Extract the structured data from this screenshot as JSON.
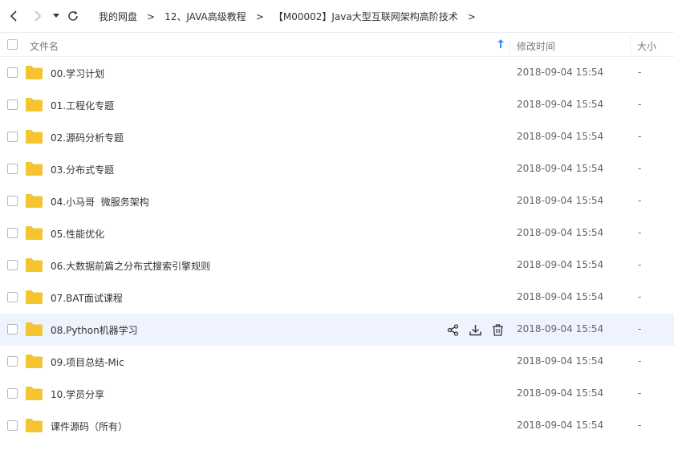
{
  "toolbar": {
    "back_icon": "chevron-left-icon",
    "forward_icon": "chevron-right-icon",
    "dropdown_icon": "caret-down-icon",
    "refresh_icon": "refresh-icon"
  },
  "breadcrumb": {
    "items": [
      "我的网盘",
      "12、JAVA高级教程",
      "【M00002】Java大型互联网架构高阶技术"
    ],
    "separator": ">"
  },
  "header": {
    "name_label": "文件名",
    "time_label": "修改时间",
    "size_label": "大小",
    "sort_icon": "arrow-up-icon"
  },
  "colors": {
    "folder": "#f5c431",
    "hover_row": "#eef3fe",
    "sort_arrow": "#3b8cff"
  },
  "files": [
    {
      "name": "00.学习计划",
      "date": "2018-09-04 15:54",
      "size": "-"
    },
    {
      "name": "01.工程化专题",
      "date": "2018-09-04 15:54",
      "size": "-"
    },
    {
      "name": "02.源码分析专题",
      "date": "2018-09-04 15:54",
      "size": "-"
    },
    {
      "name": "03.分布式专题",
      "date": "2018-09-04 15:54",
      "size": "-"
    },
    {
      "name": "04.小马哥  微服务架构",
      "date": "2018-09-04 15:54",
      "size": "-"
    },
    {
      "name": "05.性能优化",
      "date": "2018-09-04 15:54",
      "size": "-"
    },
    {
      "name": "06.大数据前篇之分布式搜索引擎规则",
      "date": "2018-09-04 15:54",
      "size": "-"
    },
    {
      "name": "07.BAT面试课程",
      "date": "2018-09-04 15:54",
      "size": "-"
    },
    {
      "name": "08.Python机器学习",
      "date": "2018-09-04 15:54",
      "size": "-"
    },
    {
      "name": "09.项目总结-Mic",
      "date": "2018-09-04 15:54",
      "size": "-"
    },
    {
      "name": "10.学员分享",
      "date": "2018-09-04 15:54",
      "size": "-"
    },
    {
      "name": "课件源码（所有）",
      "date": "2018-09-04 15:54",
      "size": "-"
    }
  ],
  "hover_row_actions": [
    "share-icon",
    "download-icon",
    "delete-icon"
  ]
}
